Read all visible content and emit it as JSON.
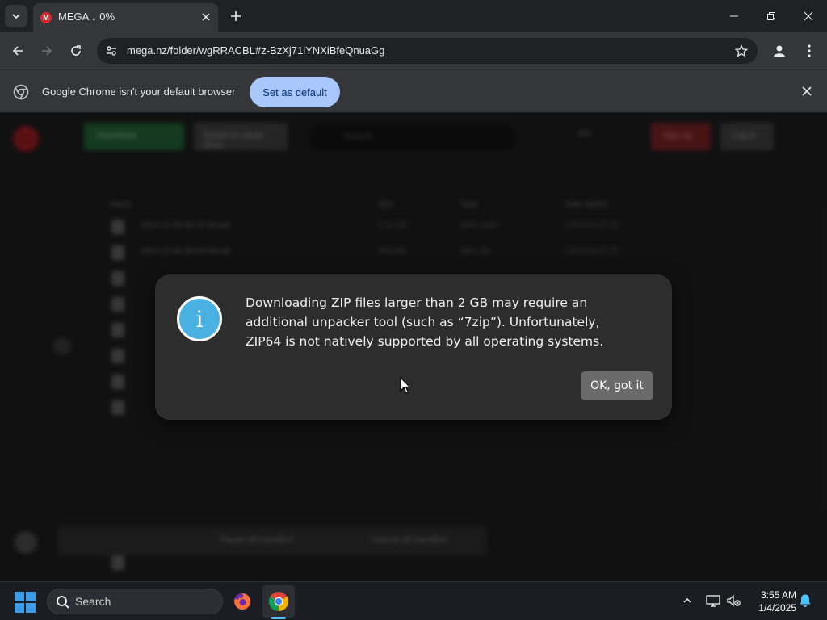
{
  "browser": {
    "tab": {
      "title": "MEGA ↓ 0%",
      "favicon": "M"
    },
    "url": "mega.nz/folder/wgRRACBL#z-BzXj71lYNXiBfeQnuaGg"
  },
  "infobar": {
    "message": "Google Chrome isn't your default browser",
    "button_label": "Set as default"
  },
  "page": {
    "download_button": "Download",
    "import_button": "Import to cloud drive",
    "search_placeholder": "Search",
    "language": "EN",
    "signup_button": "Sign up",
    "login_button": "Log in",
    "columns": [
      "Name",
      "Size",
      "Type",
      "Date added"
    ],
    "files": [
      {
        "name": "2024-12-29 09-15 Recall",
        "size": "1.01 GB",
        "type": "MP4 video",
        "date": "1/4/2025 07:22"
      },
      {
        "name": "2024-12-30 08-45 Recall",
        "size": "948 MB",
        "type": "MKV file",
        "date": "1/4/2025 07:22"
      }
    ],
    "transfer_pause": "Pause all transfers",
    "transfer_cancel": "Cancel all transfers",
    "colors": {
      "download": "#1f5a30",
      "signup": "#6d1f22"
    }
  },
  "dialog": {
    "message": "Downloading ZIP files larger than 2 GB may require an additional unpacker tool (such as “7zip”). Unfortunately, ZIP64 is not natively supported by all operating systems.",
    "ok_label": "OK, got it",
    "icon": "info-icon",
    "icon_glyph": "i",
    "accent": "#4ab1e3"
  },
  "taskbar": {
    "search_label": "Search",
    "time": "3:55 AM",
    "date": "1/4/2025"
  }
}
